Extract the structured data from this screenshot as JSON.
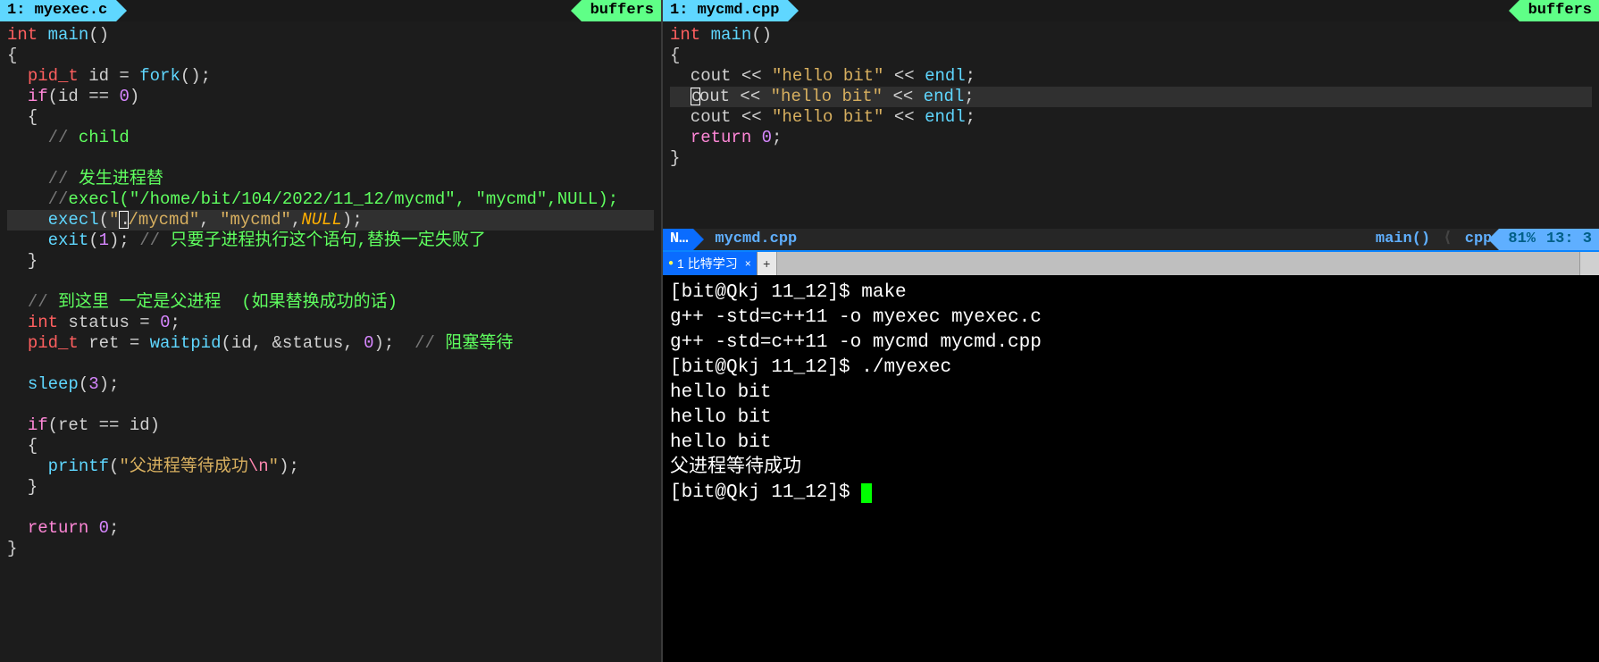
{
  "left_editor": {
    "buffer_tab": "1: myexec.c",
    "buffer_label": "buffers",
    "code": [
      {
        "t": "plain",
        "tokens": [
          {
            "c": "kw-type",
            "t": "int"
          },
          {
            "c": "",
            "t": " "
          },
          {
            "c": "fn",
            "t": "main"
          },
          {
            "c": "",
            "t": "()"
          }
        ]
      },
      {
        "t": "plain",
        "tokens": [
          {
            "c": "",
            "t": "{"
          }
        ]
      },
      {
        "t": "plain",
        "tokens": [
          {
            "c": "",
            "t": "  "
          },
          {
            "c": "kw-type",
            "t": "pid_t"
          },
          {
            "c": "",
            "t": " id = "
          },
          {
            "c": "fn",
            "t": "fork"
          },
          {
            "c": "",
            "t": "();"
          }
        ]
      },
      {
        "t": "plain",
        "tokens": [
          {
            "c": "",
            "t": "  "
          },
          {
            "c": "kw-stmt",
            "t": "if"
          },
          {
            "c": "",
            "t": "(id == "
          },
          {
            "c": "num",
            "t": "0"
          },
          {
            "c": "",
            "t": ")"
          }
        ]
      },
      {
        "t": "plain",
        "tokens": [
          {
            "c": "",
            "t": "  {"
          }
        ]
      },
      {
        "t": "plain",
        "tokens": [
          {
            "c": "",
            "t": "    "
          },
          {
            "c": "cmt",
            "t": "// "
          },
          {
            "c": "cmt-cn",
            "t": "child"
          }
        ]
      },
      {
        "t": "plain",
        "tokens": [
          {
            "c": "",
            "t": ""
          }
        ]
      },
      {
        "t": "plain",
        "tokens": [
          {
            "c": "",
            "t": "    "
          },
          {
            "c": "cmt",
            "t": "// "
          },
          {
            "c": "cmt-cn",
            "t": "发生进程替"
          }
        ]
      },
      {
        "t": "plain",
        "tokens": [
          {
            "c": "",
            "t": "    "
          },
          {
            "c": "cmt",
            "t": "//"
          },
          {
            "c": "cmt-cn",
            "t": "execl(\"/home/bit/104/2022/11_12/mycmd\", \"mycmd\",NULL);"
          }
        ]
      },
      {
        "t": "hl",
        "tokens": [
          {
            "c": "",
            "t": "    "
          },
          {
            "c": "fn",
            "t": "execl"
          },
          {
            "c": "",
            "t": "("
          },
          {
            "c": "str",
            "t": "\""
          },
          {
            "c": "",
            "t": ""
          },
          {
            "c": "caret",
            "t": "."
          },
          {
            "c": "str",
            "t": "/mycmd\""
          },
          {
            "c": "",
            "t": ", "
          },
          {
            "c": "str",
            "t": "\"mycmd\""
          },
          {
            "c": "",
            "t": ","
          },
          {
            "c": "null",
            "t": "NULL"
          },
          {
            "c": "",
            "t": ");"
          }
        ]
      },
      {
        "t": "plain",
        "tokens": [
          {
            "c": "",
            "t": "    "
          },
          {
            "c": "fn",
            "t": "exit"
          },
          {
            "c": "",
            "t": "("
          },
          {
            "c": "num",
            "t": "1"
          },
          {
            "c": "",
            "t": "); "
          },
          {
            "c": "cmt",
            "t": "// "
          },
          {
            "c": "cmt-cn",
            "t": "只要子进程执行这个语句,替换一定失败了"
          }
        ]
      },
      {
        "t": "plain",
        "tokens": [
          {
            "c": "",
            "t": "  }"
          }
        ]
      },
      {
        "t": "plain",
        "tokens": [
          {
            "c": "",
            "t": ""
          }
        ]
      },
      {
        "t": "plain",
        "tokens": [
          {
            "c": "",
            "t": "  "
          },
          {
            "c": "cmt",
            "t": "// "
          },
          {
            "c": "cmt-cn",
            "t": "到这里 一定是父进程  (如果替换成功的话)"
          }
        ]
      },
      {
        "t": "plain",
        "tokens": [
          {
            "c": "",
            "t": "  "
          },
          {
            "c": "kw-type",
            "t": "int"
          },
          {
            "c": "",
            "t": " status = "
          },
          {
            "c": "num",
            "t": "0"
          },
          {
            "c": "",
            "t": ";"
          }
        ]
      },
      {
        "t": "plain",
        "tokens": [
          {
            "c": "",
            "t": "  "
          },
          {
            "c": "kw-type",
            "t": "pid_t"
          },
          {
            "c": "",
            "t": " ret = "
          },
          {
            "c": "fn",
            "t": "waitpid"
          },
          {
            "c": "",
            "t": "(id, &status, "
          },
          {
            "c": "num",
            "t": "0"
          },
          {
            "c": "",
            "t": ");  "
          },
          {
            "c": "cmt",
            "t": "// "
          },
          {
            "c": "cmt-cn",
            "t": "阻塞等待"
          }
        ]
      },
      {
        "t": "plain",
        "tokens": [
          {
            "c": "",
            "t": ""
          }
        ]
      },
      {
        "t": "plain",
        "tokens": [
          {
            "c": "",
            "t": "  "
          },
          {
            "c": "fn",
            "t": "sleep"
          },
          {
            "c": "",
            "t": "("
          },
          {
            "c": "num",
            "t": "3"
          },
          {
            "c": "",
            "t": ");"
          }
        ]
      },
      {
        "t": "plain",
        "tokens": [
          {
            "c": "",
            "t": ""
          }
        ]
      },
      {
        "t": "plain",
        "tokens": [
          {
            "c": "",
            "t": "  "
          },
          {
            "c": "kw-stmt",
            "t": "if"
          },
          {
            "c": "",
            "t": "(ret == id)"
          }
        ]
      },
      {
        "t": "plain",
        "tokens": [
          {
            "c": "",
            "t": "  {"
          }
        ]
      },
      {
        "t": "plain",
        "tokens": [
          {
            "c": "",
            "t": "    "
          },
          {
            "c": "fn",
            "t": "printf"
          },
          {
            "c": "",
            "t": "("
          },
          {
            "c": "str",
            "t": "\"父进程等待成功"
          },
          {
            "c": "esc",
            "t": "\\n"
          },
          {
            "c": "str",
            "t": "\""
          },
          {
            "c": "",
            "t": ");"
          }
        ]
      },
      {
        "t": "plain",
        "tokens": [
          {
            "c": "",
            "t": "  }"
          }
        ]
      },
      {
        "t": "plain",
        "tokens": [
          {
            "c": "",
            "t": ""
          }
        ]
      },
      {
        "t": "plain",
        "tokens": [
          {
            "c": "",
            "t": "  "
          },
          {
            "c": "kw-stmt",
            "t": "return"
          },
          {
            "c": "",
            "t": " "
          },
          {
            "c": "num",
            "t": "0"
          },
          {
            "c": "",
            "t": ";"
          }
        ]
      },
      {
        "t": "plain",
        "tokens": [
          {
            "c": "",
            "t": "}"
          }
        ]
      }
    ]
  },
  "right_editor": {
    "buffer_tab": "1: mycmd.cpp",
    "buffer_label": "buffers",
    "code": [
      {
        "t": "plain",
        "tokens": [
          {
            "c": "kw-type",
            "t": "int"
          },
          {
            "c": "",
            "t": " "
          },
          {
            "c": "fn",
            "t": "main"
          },
          {
            "c": "",
            "t": "()"
          }
        ]
      },
      {
        "t": "plain",
        "tokens": [
          {
            "c": "",
            "t": "{"
          }
        ]
      },
      {
        "t": "plain",
        "tokens": [
          {
            "c": "",
            "t": "  cout << "
          },
          {
            "c": "str",
            "t": "\"hello bit\""
          },
          {
            "c": "",
            "t": " << "
          },
          {
            "c": "fn",
            "t": "endl"
          },
          {
            "c": "",
            "t": ";"
          }
        ]
      },
      {
        "t": "hl",
        "tokens": [
          {
            "c": "",
            "t": "  "
          },
          {
            "c": "caret",
            "t": "c"
          },
          {
            "c": "",
            "t": "out << "
          },
          {
            "c": "str",
            "t": "\"hello bit\""
          },
          {
            "c": "",
            "t": " << "
          },
          {
            "c": "fn",
            "t": "endl"
          },
          {
            "c": "",
            "t": ";"
          }
        ]
      },
      {
        "t": "plain",
        "tokens": [
          {
            "c": "",
            "t": "  cout << "
          },
          {
            "c": "str",
            "t": "\"hello bit\""
          },
          {
            "c": "",
            "t": " << "
          },
          {
            "c": "fn",
            "t": "endl"
          },
          {
            "c": "",
            "t": ";"
          }
        ]
      },
      {
        "t": "plain",
        "tokens": [
          {
            "c": "",
            "t": "  "
          },
          {
            "c": "kw-stmt",
            "t": "return"
          },
          {
            "c": "",
            "t": " "
          },
          {
            "c": "num",
            "t": "0"
          },
          {
            "c": "",
            "t": ";"
          }
        ]
      },
      {
        "t": "plain",
        "tokens": [
          {
            "c": "",
            "t": "}"
          }
        ]
      }
    ],
    "status": {
      "mode": "N…",
      "file": "mycmd.cpp",
      "func": "main()",
      "lang": "cpp",
      "pct": "81%",
      "line": "13",
      "col": "3"
    }
  },
  "terminal": {
    "tab": {
      "name": "1 比特学习"
    },
    "lines": [
      "[bit@Qkj 11_12]$ make",
      "g++ -std=c++11 -o myexec myexec.c",
      "g++ -std=c++11 -o mycmd mycmd.cpp",
      "[bit@Qkj 11_12]$ ./myexec",
      "hello bit",
      "hello bit",
      "hello bit",
      "父进程等待成功",
      "[bit@Qkj 11_12]$ "
    ]
  }
}
